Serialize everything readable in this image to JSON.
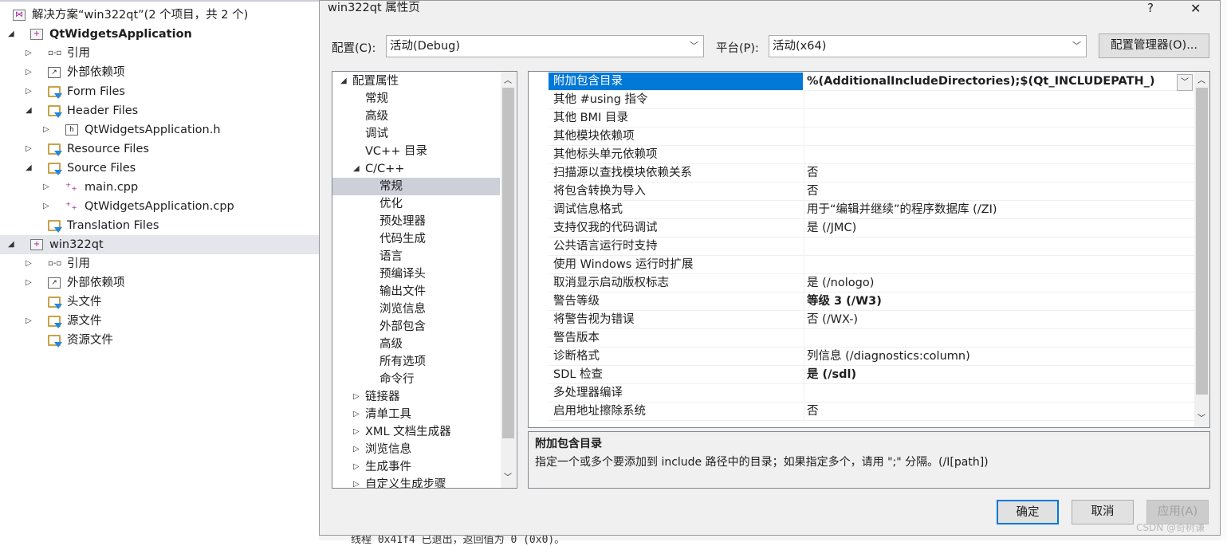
{
  "solution_explorer": {
    "items": [
      {
        "label": "解决方案“win322qt”(2 个项目，共 2 个)",
        "icon": "solution-icon",
        "indent": 0,
        "expander": "none"
      },
      {
        "label": "QtWidgetsApplication",
        "icon": "project-icon",
        "indent": 1,
        "expander": "expanded",
        "bold": true
      },
      {
        "label": "引用",
        "icon": "references-icon",
        "indent": 2,
        "expander": "collapsed"
      },
      {
        "label": "外部依赖项",
        "icon": "external-deps-icon",
        "indent": 2,
        "expander": "collapsed"
      },
      {
        "label": "Form Files",
        "icon": "filter-folder-icon",
        "indent": 2,
        "expander": "collapsed"
      },
      {
        "label": "Header Files",
        "icon": "filter-folder-icon",
        "indent": 2,
        "expander": "expanded"
      },
      {
        "label": "QtWidgetsApplication.h",
        "icon": "header-file-icon",
        "indent": 3,
        "expander": "collapsed"
      },
      {
        "label": "Resource Files",
        "icon": "filter-folder-icon",
        "indent": 2,
        "expander": "collapsed"
      },
      {
        "label": "Source Files",
        "icon": "filter-folder-icon",
        "indent": 2,
        "expander": "expanded"
      },
      {
        "label": "main.cpp",
        "icon": "cpp-file-icon",
        "indent": 3,
        "expander": "collapsed"
      },
      {
        "label": "QtWidgetsApplication.cpp",
        "icon": "cpp-file-icon",
        "indent": 3,
        "expander": "collapsed"
      },
      {
        "label": "Translation Files",
        "icon": "filter-folder-icon",
        "indent": 2,
        "expander": "none"
      },
      {
        "label": "win322qt",
        "icon": "project-icon",
        "indent": 1,
        "expander": "expanded",
        "selected": true
      },
      {
        "label": "引用",
        "icon": "references-icon",
        "indent": 2,
        "expander": "collapsed"
      },
      {
        "label": "外部依赖项",
        "icon": "external-deps-icon",
        "indent": 2,
        "expander": "collapsed"
      },
      {
        "label": "头文件",
        "icon": "filter-folder-icon",
        "indent": 2,
        "expander": "none"
      },
      {
        "label": "源文件",
        "icon": "filter-folder-icon",
        "indent": 2,
        "expander": "collapsed"
      },
      {
        "label": "资源文件",
        "icon": "filter-folder-icon",
        "indent": 2,
        "expander": "none"
      }
    ]
  },
  "dialog": {
    "title": "win322qt 属性页",
    "help": "?",
    "close": "✕",
    "config_label": "配置(C):",
    "config_value": "活动(Debug)",
    "platform_label": "平台(P):",
    "platform_value": "活动(x64)",
    "config_manager": "配置管理器(O)...",
    "tree": [
      {
        "label": "配置属性",
        "indent": 0,
        "expander": "expanded"
      },
      {
        "label": "常规",
        "indent": 1
      },
      {
        "label": "高级",
        "indent": 1
      },
      {
        "label": "调试",
        "indent": 1
      },
      {
        "label": "VC++ 目录",
        "indent": 1
      },
      {
        "label": "C/C++",
        "indent": 1,
        "expander": "expanded"
      },
      {
        "label": "常规",
        "indent": 2,
        "selected": true
      },
      {
        "label": "优化",
        "indent": 2
      },
      {
        "label": "预处理器",
        "indent": 2
      },
      {
        "label": "代码生成",
        "indent": 2
      },
      {
        "label": "语言",
        "indent": 2
      },
      {
        "label": "预编译头",
        "indent": 2
      },
      {
        "label": "输出文件",
        "indent": 2
      },
      {
        "label": "浏览信息",
        "indent": 2
      },
      {
        "label": "外部包含",
        "indent": 2
      },
      {
        "label": "高级",
        "indent": 2
      },
      {
        "label": "所有选项",
        "indent": 2
      },
      {
        "label": "命令行",
        "indent": 2
      },
      {
        "label": "链接器",
        "indent": 1,
        "expander": "collapsed"
      },
      {
        "label": "清单工具",
        "indent": 1,
        "expander": "collapsed"
      },
      {
        "label": "XML 文档生成器",
        "indent": 1,
        "expander": "collapsed"
      },
      {
        "label": "浏览信息",
        "indent": 1,
        "expander": "collapsed"
      },
      {
        "label": "生成事件",
        "indent": 1,
        "expander": "collapsed"
      },
      {
        "label": "自定义生成步骤",
        "indent": 1,
        "expander": "collapsed"
      }
    ],
    "properties": [
      {
        "name": "附加包含目录",
        "value": "%(AdditionalIncludeDirectories);$(Qt_INCLUDEPATH_)",
        "bold": true,
        "selected": true
      },
      {
        "name": "其他 #using 指令",
        "value": ""
      },
      {
        "name": "其他 BMI 目录",
        "value": ""
      },
      {
        "name": "其他模块依赖项",
        "value": ""
      },
      {
        "name": "其他标头单元依赖项",
        "value": ""
      },
      {
        "name": "扫描源以查找模块依赖关系",
        "value": "否"
      },
      {
        "name": "将包含转换为导入",
        "value": "否"
      },
      {
        "name": "调试信息格式",
        "value": "用于“编辑并继续”的程序数据库 (/ZI)"
      },
      {
        "name": "支持仅我的代码调试",
        "value": "是 (/JMC)"
      },
      {
        "name": "公共语言运行时支持",
        "value": ""
      },
      {
        "name": "使用 Windows 运行时扩展",
        "value": ""
      },
      {
        "name": "取消显示启动版权标志",
        "value": "是 (/nologo)"
      },
      {
        "name": "警告等级",
        "value": "等级 3 (/W3)",
        "bold": true
      },
      {
        "name": "将警告视为错误",
        "value": "否 (/WX-)"
      },
      {
        "name": "警告版本",
        "value": ""
      },
      {
        "name": "诊断格式",
        "value": "列信息 (/diagnostics:column)"
      },
      {
        "name": "SDL 检查",
        "value": "是 (/sdl)",
        "bold": true
      },
      {
        "name": "多处理器编译",
        "value": ""
      },
      {
        "name": "启用地址擦除系统",
        "value": "否"
      }
    ],
    "description": {
      "title": "附加包含目录",
      "text": "指定一个或多个要添加到 include 路径中的目录；如果指定多个，请用 \";\" 分隔。(/I[path])"
    },
    "ok": "确定",
    "cancel": "取消",
    "apply": "应用(A)"
  },
  "output_fragment": "线程 0x41f4 已退出，返回值为 0 (0x0)。",
  "watermark": "CSDN @奇树谦",
  "colors": {
    "selection": "#0078d7",
    "tree_selection": "#cdd0d9",
    "dialog_bg": "#f0f0f0"
  }
}
